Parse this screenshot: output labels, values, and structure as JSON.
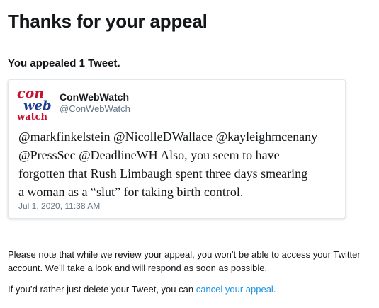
{
  "page": {
    "title": "Thanks for your appeal",
    "subtitle": "You appealed 1 Tweet."
  },
  "tweet": {
    "avatar": {
      "logo_lines": [
        "con",
        "web",
        "watch"
      ],
      "colors": {
        "con": "#c8102e",
        "web": "#1f3a93",
        "watch": "#c8102e"
      }
    },
    "display_name": "ConWebWatch",
    "handle": "@ConWebWatch",
    "text_lines": [
      "@markfinkelstein @NicolleDWallace @kayleighmcenany",
      "@PressSec @DeadlineWH Also, you seem to have",
      "forgotten that Rush Limbaugh spent three days smearing",
      "a woman as a “slut” for taking birth control."
    ],
    "timestamp": "Jul 1, 2020, 11:38 AM"
  },
  "notice": {
    "review_text": "Please note that while we review your appeal, you won’t be able to access your Twitter account. We’ll take a look and will respond as soon as possible.",
    "delete_prefix": "If you’d rather just delete your Tweet, you can ",
    "cancel_link_label": "cancel your appeal",
    "delete_suffix": "."
  },
  "colors": {
    "text": "#14171a",
    "secondary_text": "#657786",
    "link": "#1b95e0",
    "card_border": "#e1e8ed"
  }
}
